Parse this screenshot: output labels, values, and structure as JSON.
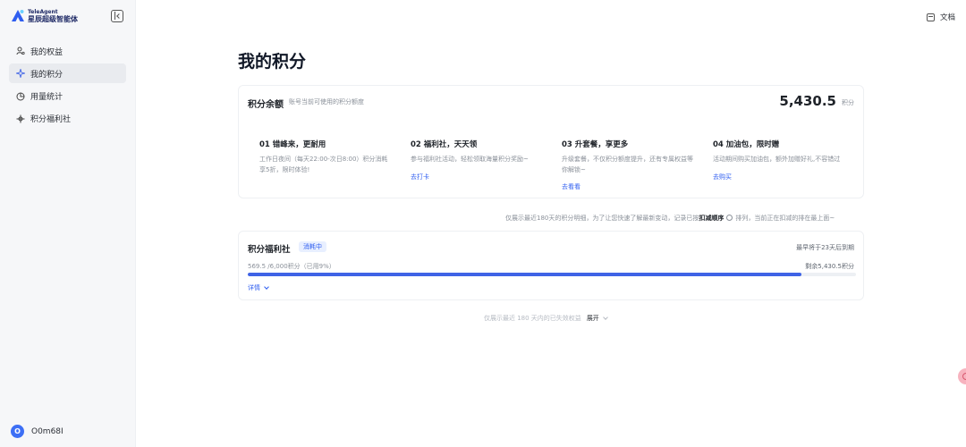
{
  "brand": {
    "name_en": "TeleAgent",
    "name_cn": "星辰超级智能体"
  },
  "sidebar": {
    "items": [
      {
        "label": "我的权益",
        "icon": "person-icon",
        "active": false
      },
      {
        "label": "我的积分",
        "icon": "sparkle-icon",
        "active": true
      },
      {
        "label": "用量统计",
        "icon": "pie-chart-icon",
        "active": false
      },
      {
        "label": "积分福利社",
        "icon": "gift-icon",
        "active": false
      }
    ]
  },
  "user": {
    "avatar_letter": "O",
    "name": "O0m68I"
  },
  "header": {
    "doc_label": "文档"
  },
  "page": {
    "title": "我的积分"
  },
  "balance": {
    "title": "积分余额",
    "subtitle": "账号当前可使用的积分额度",
    "value": "5,430.5",
    "unit": "积分"
  },
  "steps": [
    {
      "title": "01 错峰来，更耐用",
      "desc": "工作日夜间（每天22:00-次日8:00）积分消耗享5折，限时体验!",
      "link": ""
    },
    {
      "title": "02 福利社，天天领",
      "desc": "参与福利社活动，轻松领取海量积分奖励~",
      "link": "去打卡"
    },
    {
      "title": "03 升套餐，享更多",
      "desc": "升级套餐，不仅积分额度提升，还有专属权益等你解锁~",
      "link": "去看看"
    },
    {
      "title": "04 加油包，限时赠",
      "desc": "活动期间购买加油包，额外加赠好礼,不容错过",
      "link": "去购买"
    }
  ],
  "notice": {
    "before": "仅展示最近180天的积分明细，为了让您快速了解最新变动，记录已按",
    "bold": "扣减顺序",
    "after": "排列，当前正在扣减的排在最上面~"
  },
  "welfare": {
    "title": "积分福利社",
    "badge": "消耗中",
    "expire": "最早将于23天后到期",
    "usage": "569.5 /6,000积分（已用9%）",
    "remaining": "剩余5,430.5积分",
    "progress_percent": 9,
    "detail_label": "详情"
  },
  "expired": {
    "text": "仅展示最近 180 天内的已失效权益",
    "link": "展开"
  },
  "colors": {
    "accent": "#3f63e6",
    "link": "#2f5ef0",
    "brand": "#1f2a66"
  }
}
